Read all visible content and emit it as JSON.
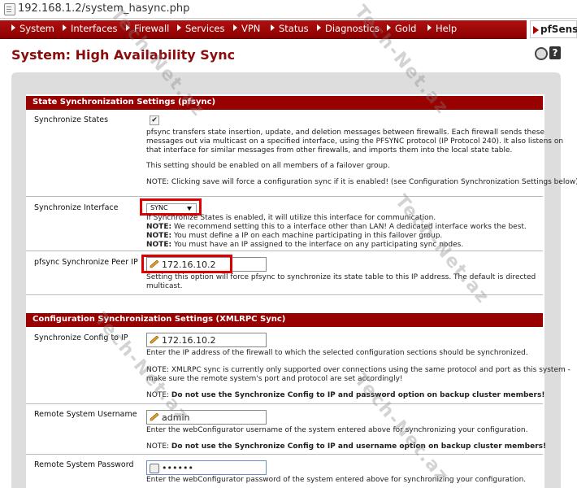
{
  "browser": {
    "url": "192.168.1.2/system_hasync.php"
  },
  "nav": {
    "items": [
      "System",
      "Interfaces",
      "Firewall",
      "Services",
      "VPN",
      "Status",
      "Diagnostics",
      "Gold",
      "Help"
    ],
    "logo": "pfSense."
  },
  "page": {
    "title": "System: High Availability Sync"
  },
  "state_sync": {
    "header": "State Synchronization Settings (pfsync)",
    "sync_states": {
      "label": "Synchronize States",
      "checked": true,
      "desc": [
        "pfsync transfers state insertion, update, and deletion messages between firewalls. Each firewall sends these",
        "messages out via multicast on a specified interface, using the PFSYNC protocol (IP Protocol 240). It also listens on",
        "that interface for similar messages from other firewalls, and imports them into the local state table."
      ],
      "desc2": "This setting should be enabled on all members of a failover group.",
      "desc3": "NOTE: Clicking save will force a configuration sync if it is enabled! (see Configuration Synchronization Settings below)"
    },
    "sync_interface": {
      "label": "Synchronize Interface",
      "value": "SYNC",
      "desc1": "If Synchronize States is enabled, it will utilize this interface for communication.",
      "note1_b": "NOTE:",
      "note1": " We recommend setting this to a interface other than LAN! A dedicated interface works the best.",
      "note2_b": "NOTE:",
      "note2": " You must define a IP on each machine participating in this failover group.",
      "note3_b": "NOTE:",
      "note3": " You must have an IP assigned to the interface on any participating sync nodes."
    },
    "peer_ip": {
      "label": "pfsync Synchronize Peer IP",
      "value": "172.16.10.2",
      "desc1": "Setting this option will force pfsync to synchronize its state table to this IP address. The default is directed",
      "desc2": "multicast."
    }
  },
  "config_sync": {
    "header": "Configuration Synchronization Settings (XMLRPC Sync)",
    "config_ip": {
      "label": "Synchronize Config to IP",
      "value": "172.16.10.2",
      "desc1": "Enter the IP address of the firewall to which the selected configuration sections should be synchronized.",
      "desc2": "NOTE: XMLRPC sync is currently only supported over connections using the same protocol and port as this system -",
      "desc3": "make sure the remote system's port and protocol are set accordingly!",
      "desc4_a": "NOTE: ",
      "desc4_b": "Do not use the Synchronize Config to IP and password option on backup cluster members!"
    },
    "username": {
      "label": "Remote System Username",
      "value": "admin",
      "desc1": "Enter the webConfigurator username of the system entered above for synchronizing your configuration.",
      "desc2_a": "NOTE: ",
      "desc2_b": "Do not use the Synchronize Config to IP and username option on backup cluster members!"
    },
    "password": {
      "label": "Remote System Password",
      "value": "••••••",
      "desc1": "Enter the webConfigurator password of the system entered above for synchronizing your configuration."
    }
  },
  "watermark": "Tech-Net.az",
  "colors": {
    "accent": "#990000",
    "highlight": "#dd0000"
  }
}
